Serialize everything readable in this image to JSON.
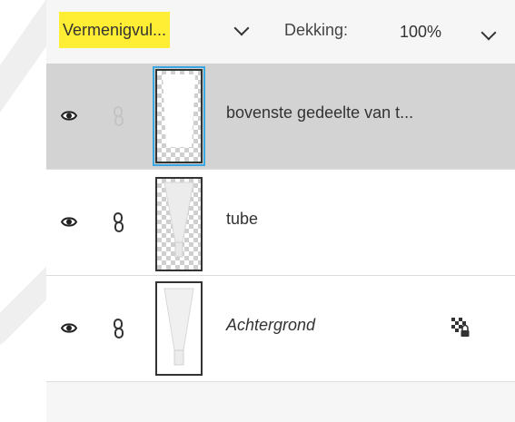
{
  "toolbar": {
    "blend_mode": "Vermenigvul...",
    "opacity_label": "Dekking:",
    "opacity_value": "100%"
  },
  "colors": {
    "highlight": "#ffee33",
    "selected_row": "#d3d3d3",
    "active_thumb_border": "#3aa7e0"
  },
  "layers": [
    {
      "name": "bovenste gedeelte van t...",
      "selected": true,
      "visible": true,
      "linked_icon": "link-icon",
      "italic": false
    },
    {
      "name": "tube",
      "selected": false,
      "visible": true,
      "linked_icon": "link-icon",
      "italic": false
    },
    {
      "name": "Achtergrond",
      "selected": false,
      "visible": true,
      "linked_icon": "link-icon",
      "italic": true,
      "locked_icon": "locked-transparency-icon"
    }
  ]
}
